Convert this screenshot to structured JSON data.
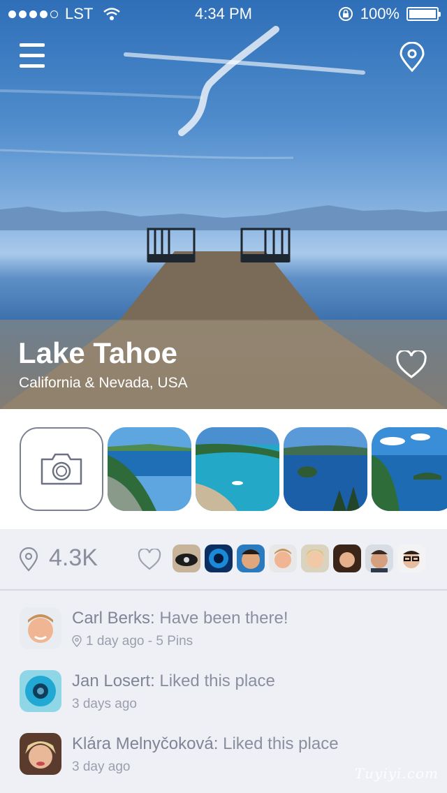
{
  "status_bar": {
    "carrier": "LST",
    "time": "4:34 PM",
    "battery": "100%",
    "battery_level": 1.0
  },
  "hero": {
    "title": "Lake Tahoe",
    "subtitle": "California & Nevada, USA"
  },
  "gallery": {
    "photos": [
      "photo-1",
      "photo-2",
      "photo-3",
      "photo-4",
      "photo-5"
    ]
  },
  "stats": {
    "pins_count": "4.3K",
    "likers": [
      "liker-1",
      "liker-2",
      "liker-3",
      "liker-4",
      "liker-5",
      "liker-6",
      "liker-7",
      "liker-8"
    ]
  },
  "activity": [
    {
      "name": "Carl Berks:",
      "action": "Have been there!",
      "meta": "1 day ago - 5 Pins",
      "show_pin_icon": true
    },
    {
      "name": "Jan Losert:",
      "action": "Liked this place",
      "meta": "3 days ago",
      "show_pin_icon": false
    },
    {
      "name": "Klára Melnyčoková:",
      "action": "Liked this place",
      "meta": "3 day ago",
      "show_pin_icon": false
    }
  ],
  "watermark": "Tuyiyi.com",
  "colors": {
    "accent_text": "#7f8497",
    "background": "#eff0f5",
    "white": "#ffffff"
  },
  "icons": [
    "menu-icon",
    "location-pin-icon",
    "heart-icon",
    "camera-icon",
    "wifi-icon",
    "lock-rotation-icon",
    "battery-icon"
  ]
}
